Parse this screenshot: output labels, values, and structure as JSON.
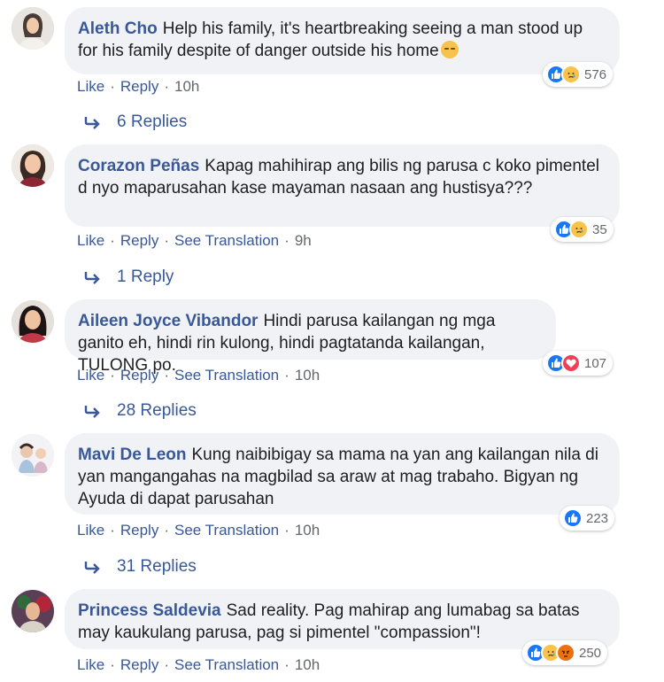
{
  "comments": [
    {
      "author": "Aleth Cho",
      "text": "Help his family, it's heartbreaking seeing a man stood up for his family despite of danger outside his home",
      "has_emoji": true,
      "reactions": [
        "like",
        "sad"
      ],
      "reaction_count": "576",
      "actions": [
        "Like",
        "Reply"
      ],
      "time": "10h",
      "replies": "6 Replies"
    },
    {
      "author": "Corazon Peñas",
      "text": "Kapag mahihirap ang bilis ng parusa c koko pimentel d nyo maparusahan kase mayaman nasaan ang hustisya???",
      "reactions": [
        "like",
        "sad"
      ],
      "reaction_count": "35",
      "actions": [
        "Like",
        "Reply",
        "See Translation"
      ],
      "time": "9h",
      "replies": "1 Reply"
    },
    {
      "author": "Aileen Joyce Vibandor",
      "text": "Hindi parusa kailangan ng mga ganito eh, hindi rin kulong, hindi pagtatanda kailangan, TULONG po.",
      "reactions": [
        "like",
        "love"
      ],
      "reaction_count": "107",
      "actions": [
        "Like",
        "Reply",
        "See Translation"
      ],
      "time": "10h",
      "replies": "28 Replies"
    },
    {
      "author": "Mavi De Leon",
      "text": "Kung naibibigay sa mama na yan ang kailangan nila di yan mangangahas na magbilad sa araw at mag trabaho. Bigyan ng Ayuda di dapat parusahan",
      "reactions": [
        "like"
      ],
      "reaction_count": "223",
      "actions": [
        "Like",
        "Reply",
        "See Translation"
      ],
      "time": "10h",
      "replies": "31 Replies"
    },
    {
      "author": "Princess Saldevia",
      "text": "Sad reality. Pag mahirap ang lumabag sa batas may kaukulang parusa, pag si pimentel \"compassion\"!",
      "reactions": [
        "like",
        "sad",
        "angry"
      ],
      "reaction_count": "250",
      "actions": [
        "Like",
        "Reply",
        "See Translation"
      ],
      "time": "10h"
    }
  ],
  "colors": {
    "link": "#385898",
    "bubble": "#f0f2f5",
    "meta": "#65676b",
    "like": "#1877f2"
  }
}
